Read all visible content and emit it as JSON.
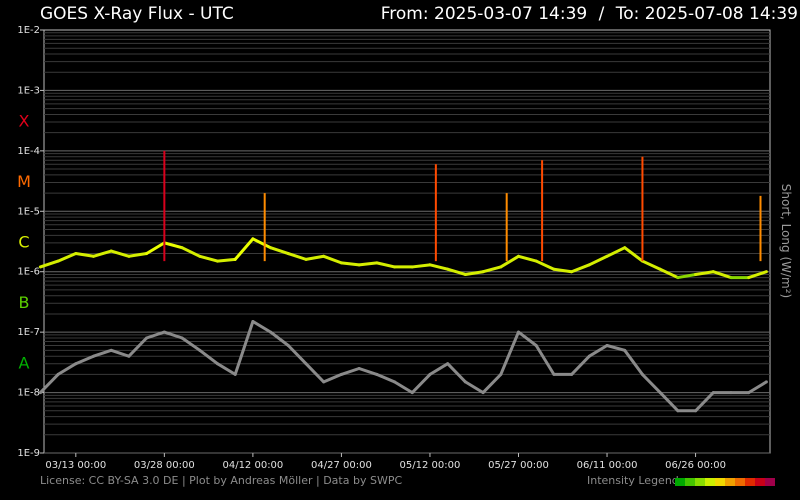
{
  "header": {
    "title": "GOES X-Ray Flux - UTC",
    "from_label": "From:",
    "from_value": "2025-03-07 14:39",
    "separator": "/",
    "to_label": "To:",
    "to_value": "2025-07-08 14:39"
  },
  "footer": {
    "credits": "License: CC BY-SA 3.0 DE | Plot by Andreas Möller | Data by SWPC",
    "legend_label": "Intensity Legend",
    "legend_colors": [
      "#00a800",
      "#44c400",
      "#88dc00",
      "#ccee00",
      "#f0d800",
      "#f0a000",
      "#ee6a00",
      "#e02a00",
      "#c80018",
      "#a0004a"
    ]
  },
  "chart_data": {
    "type": "line",
    "title": "GOES X-Ray Flux - UTC",
    "ylabel": "Short, Long (W/m²)",
    "xlabel": "",
    "yscale": "log",
    "ylim": [
      1e-09,
      0.01
    ],
    "y_ticks": [
      {
        "value": 0.01,
        "label": "1E-2"
      },
      {
        "value": 0.001,
        "label": "1E-3"
      },
      {
        "value": 0.0001,
        "label": "1E-4"
      },
      {
        "value": 1e-05,
        "label": "1E-5"
      },
      {
        "value": 1e-06,
        "label": "1E-6"
      },
      {
        "value": 1e-07,
        "label": "1E-7"
      },
      {
        "value": 1e-08,
        "label": "1E-8"
      },
      {
        "value": 1e-09,
        "label": "1E-9"
      }
    ],
    "flare_classes": [
      {
        "label": "X",
        "value": 0.0003162,
        "color": "#e0001a"
      },
      {
        "label": "M",
        "value": 3.162e-05,
        "color": "#ff6a00"
      },
      {
        "label": "C",
        "value": 3.162e-06,
        "color": "#d8f000"
      },
      {
        "label": "B",
        "value": 3.162e-07,
        "color": "#5cd000"
      },
      {
        "label": "A",
        "value": 3.162e-08,
        "color": "#00b000"
      }
    ],
    "xlim": [
      "2025-03-07 14:39",
      "2025-07-08 14:39"
    ],
    "x_ticks": [
      {
        "date": "2025-03-13",
        "label": "03/13 00:00"
      },
      {
        "date": "2025-03-28",
        "label": "03/28 00:00"
      },
      {
        "date": "2025-04-12",
        "label": "04/12 00:00"
      },
      {
        "date": "2025-04-27",
        "label": "04/27 00:00"
      },
      {
        "date": "2025-05-12",
        "label": "05/12 00:00"
      },
      {
        "date": "2025-05-27",
        "label": "05/27 00:00"
      },
      {
        "date": "2025-06-11",
        "label": "06/11 00:00"
      },
      {
        "date": "2025-06-26",
        "label": "06/26 00:00"
      }
    ],
    "grid": true,
    "series": [
      {
        "key": "long",
        "color_by": "flare class",
        "dates": [
          "2025-03-07",
          "2025-03-10",
          "2025-03-13",
          "2025-03-16",
          "2025-03-19",
          "2025-03-22",
          "2025-03-25",
          "2025-03-28",
          "2025-03-31",
          "2025-04-03",
          "2025-04-06",
          "2025-04-09",
          "2025-04-12",
          "2025-04-15",
          "2025-04-18",
          "2025-04-21",
          "2025-04-24",
          "2025-04-27",
          "2025-04-30",
          "2025-05-03",
          "2025-05-06",
          "2025-05-09",
          "2025-05-12",
          "2025-05-15",
          "2025-05-18",
          "2025-05-21",
          "2025-05-24",
          "2025-05-27",
          "2025-05-30",
          "2025-06-02",
          "2025-06-05",
          "2025-06-08",
          "2025-06-11",
          "2025-06-14",
          "2025-06-17",
          "2025-06-20",
          "2025-06-23",
          "2025-06-26",
          "2025-06-29",
          "2025-07-02",
          "2025-07-05",
          "2025-07-08"
        ],
        "values": [
          1.2e-06,
          1.5e-06,
          2e-06,
          1.8e-06,
          2.2e-06,
          1.8e-06,
          2e-06,
          3e-06,
          2.5e-06,
          1.8e-06,
          1.5e-06,
          1.6e-06,
          3.5e-06,
          2.5e-06,
          2e-06,
          1.6e-06,
          1.8e-06,
          1.4e-06,
          1.3e-06,
          1.4e-06,
          1.2e-06,
          1.2e-06,
          1.3e-06,
          1.1e-06,
          9e-07,
          1e-06,
          1.2e-06,
          1.8e-06,
          1.5e-06,
          1.1e-06,
          1e-06,
          1.3e-06,
          1.8e-06,
          2.5e-06,
          1.5e-06,
          1.1e-06,
          8e-07,
          9e-07,
          1e-06,
          8e-07,
          8e-07,
          1e-06
        ],
        "peaks": [
          {
            "date": "2025-03-28",
            "value": 0.0001
          },
          {
            "date": "2025-04-14",
            "value": 2e-05
          },
          {
            "date": "2025-05-13",
            "value": 6e-05
          },
          {
            "date": "2025-05-25",
            "value": 2e-05
          },
          {
            "date": "2025-05-31",
            "value": 7e-05
          },
          {
            "date": "2025-06-17",
            "value": 8e-05
          },
          {
            "date": "2025-07-07",
            "value": 1.8e-05
          }
        ]
      },
      {
        "key": "short",
        "color": "#8a8a8a",
        "dates": [
          "2025-03-07",
          "2025-03-10",
          "2025-03-13",
          "2025-03-16",
          "2025-03-19",
          "2025-03-22",
          "2025-03-25",
          "2025-03-28",
          "2025-03-31",
          "2025-04-03",
          "2025-04-06",
          "2025-04-09",
          "2025-04-12",
          "2025-04-15",
          "2025-04-18",
          "2025-04-21",
          "2025-04-24",
          "2025-04-27",
          "2025-04-30",
          "2025-05-03",
          "2025-05-06",
          "2025-05-09",
          "2025-05-12",
          "2025-05-15",
          "2025-05-18",
          "2025-05-21",
          "2025-05-24",
          "2025-05-27",
          "2025-05-30",
          "2025-06-02",
          "2025-06-05",
          "2025-06-08",
          "2025-06-11",
          "2025-06-14",
          "2025-06-17",
          "2025-06-20",
          "2025-06-23",
          "2025-06-26",
          "2025-06-29",
          "2025-07-02",
          "2025-07-05",
          "2025-07-08"
        ],
        "values": [
          1e-08,
          2e-08,
          3e-08,
          4e-08,
          5e-08,
          4e-08,
          8e-08,
          1e-07,
          8e-08,
          5e-08,
          3e-08,
          2e-08,
          1.5e-07,
          1e-07,
          6e-08,
          3e-08,
          1.5e-08,
          2e-08,
          2.5e-08,
          2e-08,
          1.5e-08,
          1e-08,
          2e-08,
          3e-08,
          1.5e-08,
          1e-08,
          2e-08,
          1e-07,
          6e-08,
          2e-08,
          2e-08,
          4e-08,
          6e-08,
          5e-08,
          2e-08,
          1e-08,
          5e-09,
          5e-09,
          1e-08,
          1e-08,
          1e-08,
          1.5e-08
        ]
      }
    ]
  }
}
